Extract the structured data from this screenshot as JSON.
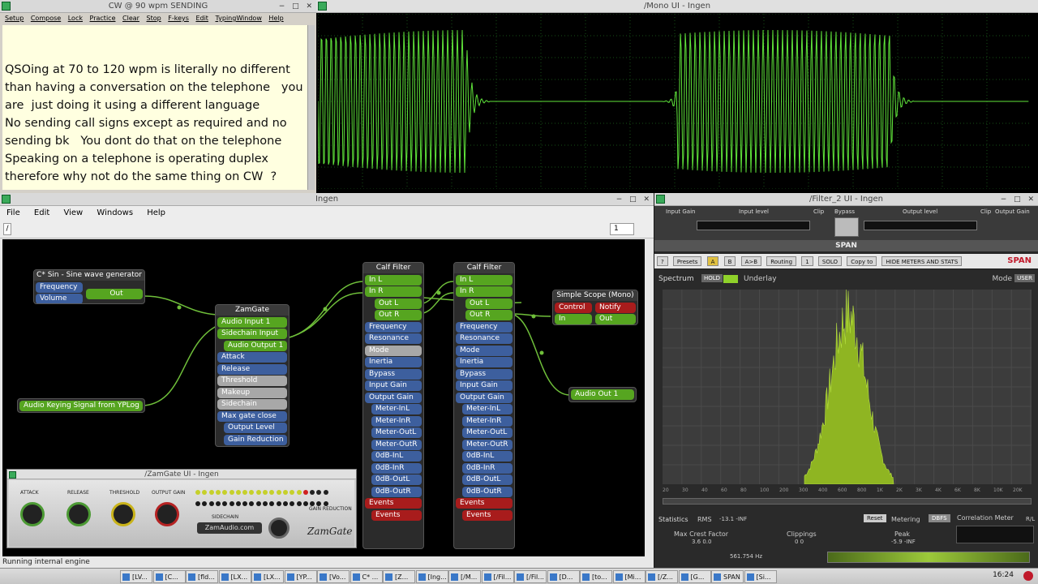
{
  "cw": {
    "title": "CW @ 90 wpm  SENDING",
    "menu": [
      "Setup",
      "Compose",
      "Lock",
      "Practice",
      "Clear",
      "Stop",
      "F-keys",
      "Edit",
      "TypingWindow",
      "Help"
    ],
    "text": "QSOing at 70 to 120 wpm is literally no different\nthan having a conversation on the telephone   you\nare  just doing it using a different language\nNo sending call signs except as required and no\nsending bk   You dont do that on the telephone\nSpeaking on a telephone is operating duplex\ntherefore why not do the same thing on CW  ?"
  },
  "mono": {
    "title": "/Mono UI - Ingen"
  },
  "ingen": {
    "title": "Ingen",
    "menu": [
      "File",
      "Edit",
      "View",
      "Windows",
      "Help"
    ],
    "path": "/",
    "zoom": "1",
    "status": "Running internal engine",
    "blocks": {
      "sine": {
        "title": "C* Sin - Sine wave generator",
        "ports": [
          "Frequency",
          "Volume"
        ],
        "out": "Out"
      },
      "zamgate": {
        "title": "ZamGate",
        "ports": [
          "Audio Input 1",
          "Sidechain Input",
          "Audio Output 1",
          "Attack",
          "Release",
          "Threshold",
          "Makeup",
          "Sidechain",
          "Max gate close",
          "Output Level",
          "Gain Reduction"
        ]
      },
      "keying": {
        "label": "Audio Keying Signal from YPLog"
      },
      "calf1": {
        "title": "Calf Filter",
        "ports": [
          "In L",
          "In R",
          "Out L",
          "Out R",
          "Frequency",
          "Resonance",
          "Mode",
          "Inertia",
          "Bypass",
          "Input Gain",
          "Output Gain",
          "Meter-InL",
          "Meter-InR",
          "Meter-OutL",
          "Meter-OutR",
          "0dB-InL",
          "0dB-InR",
          "0dB-OutL",
          "0dB-OutR",
          "Events",
          "Events"
        ]
      },
      "calf2": {
        "title": "Calf Filter",
        "ports": [
          "In L",
          "In R",
          "Out L",
          "Out R",
          "Frequency",
          "Resonance",
          "Mode",
          "Inertia",
          "Bypass",
          "Input Gain",
          "Output Gain",
          "Meter-InL",
          "Meter-InR",
          "Meter-OutL",
          "Meter-OutR",
          "0dB-InL",
          "0dB-InR",
          "0dB-OutL",
          "0dB-OutR",
          "Events",
          "Events"
        ]
      },
      "scope": {
        "title": "Simple Scope (Mono)",
        "ports": [
          "Control",
          "Notify",
          "In",
          "Out"
        ]
      },
      "audioout": {
        "label": "Audio Out 1"
      }
    }
  },
  "zamgateui": {
    "title": "/ZamGate UI - Ingen",
    "labels": [
      "ATTACK",
      "RELEASE",
      "THRESHOLD",
      "OUTPUT GAIN"
    ],
    "logo": "ZamAudio.com",
    "brand": "ZamGate",
    "sidechain": "SIDECHAIN",
    "gain_reduction": "GAIN REDUCTION"
  },
  "filter2": {
    "title": "/Filter_2 UI - Ingen",
    "strip": [
      "Input Gain",
      "Input level",
      "Clip",
      "Bypass",
      "Output level",
      "Clip",
      "Output Gain"
    ]
  },
  "span": {
    "header": "SPAN",
    "toolbar": [
      "?",
      "Presets",
      "A",
      "B",
      "A>B",
      "Routing",
      "1",
      "SOLO",
      "Copy to",
      "HIDE METERS AND STATS"
    ],
    "brand": "SPAN",
    "spectrum_label": "Spectrum",
    "hold": "HOLD",
    "underlay": "Underlay",
    "mode": "Mode",
    "mode_value": "USER",
    "freq_ticks": [
      "20",
      "30",
      "40",
      "60",
      "80",
      "100",
      "200",
      "300",
      "400",
      "600",
      "800",
      "1K",
      "2K",
      "3K",
      "4K",
      "6K",
      "8K",
      "10K",
      "20K"
    ],
    "stats": {
      "label": "Statistics",
      "rms": "RMS",
      "rms_vals": "-13.1  -INF",
      "reset": "Reset",
      "metering": "Metering",
      "dbfs": "DBFS",
      "corr": "Correlation Meter",
      "corr_val": "R/L",
      "crest": "Max Crest Factor",
      "crest_vals": "3.6   0.0",
      "clip": "Clippings",
      "clip_vals": "0   0",
      "peak": "Peak",
      "peak_vals": "-5.9  -INF",
      "freq": "561.754 Hz"
    }
  },
  "taskbar": {
    "items": [
      "[LV...",
      "[C...",
      "[fld...",
      "[LX...",
      "[LX...",
      "[YP...",
      "[Vo...",
      "C* ...",
      "[Z...",
      "[Ing...",
      "[/M...",
      "[/Fil...",
      "[/Fil...",
      "[D...",
      "[to...",
      "[Mi...",
      "[/Z...",
      "[G...",
      "SPAN",
      "[Si..."
    ],
    "clock": "16:24"
  }
}
